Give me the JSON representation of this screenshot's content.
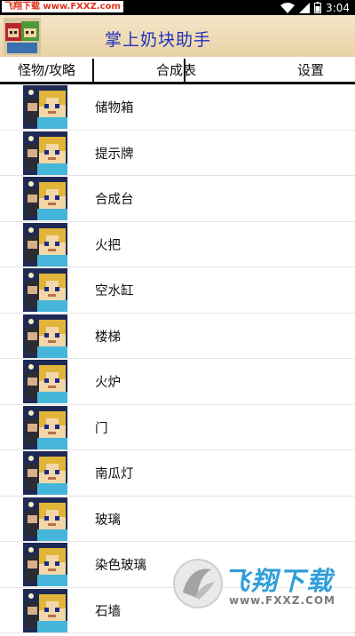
{
  "status_bar": {
    "watermark_text": "飞翔下载 www.FXXZ.com",
    "time": "3:04"
  },
  "header": {
    "title": "掌上奶块助手"
  },
  "tabs": [
    {
      "label": "怪物/攻略"
    },
    {
      "label": "合成表"
    },
    {
      "label": "设置"
    }
  ],
  "list": {
    "items": [
      {
        "label": "储物箱"
      },
      {
        "label": "提示牌"
      },
      {
        "label": "合成台"
      },
      {
        "label": "火把"
      },
      {
        "label": "空水缸"
      },
      {
        "label": "楼梯"
      },
      {
        "label": "火炉"
      },
      {
        "label": "门"
      },
      {
        "label": "南瓜灯"
      },
      {
        "label": "玻璃"
      },
      {
        "label": "染色玻璃"
      },
      {
        "label": "石墙"
      }
    ]
  },
  "watermark": {
    "brand": "飞翔下载",
    "url": "www.FXXZ.COM"
  },
  "icons": {
    "thumbnail": "pixel-character-icon",
    "wifi": "wifi-icon",
    "signal": "signal-icon",
    "battery": "battery-icon"
  }
}
